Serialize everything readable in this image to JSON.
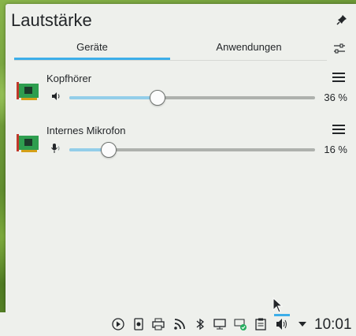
{
  "popup": {
    "title": "Lautstärke",
    "tabs": [
      {
        "label": "Geräte",
        "active": true
      },
      {
        "label": "Anwendungen",
        "active": false
      }
    ]
  },
  "devices": [
    {
      "name": "Kopfhörer",
      "volume_percent": 36,
      "volume_label": "36 %",
      "type": "output"
    },
    {
      "name": "Internes Mikrofon",
      "volume_percent": 16,
      "volume_label": "16 %",
      "type": "input"
    }
  ],
  "taskbar": {
    "clock": "10:01",
    "icons": [
      "media-play-icon",
      "phone-icon",
      "printer-icon",
      "rss-icon",
      "bluetooth-icon",
      "monitor-icon",
      "network-check-icon",
      "clipboard-icon",
      "volume-icon",
      "expand-arrow-icon"
    ]
  },
  "colors": {
    "accent": "#3daee9",
    "slider_fill": "#93cee9",
    "slider_track": "#aeb1ad",
    "background": "#eef0ec"
  }
}
